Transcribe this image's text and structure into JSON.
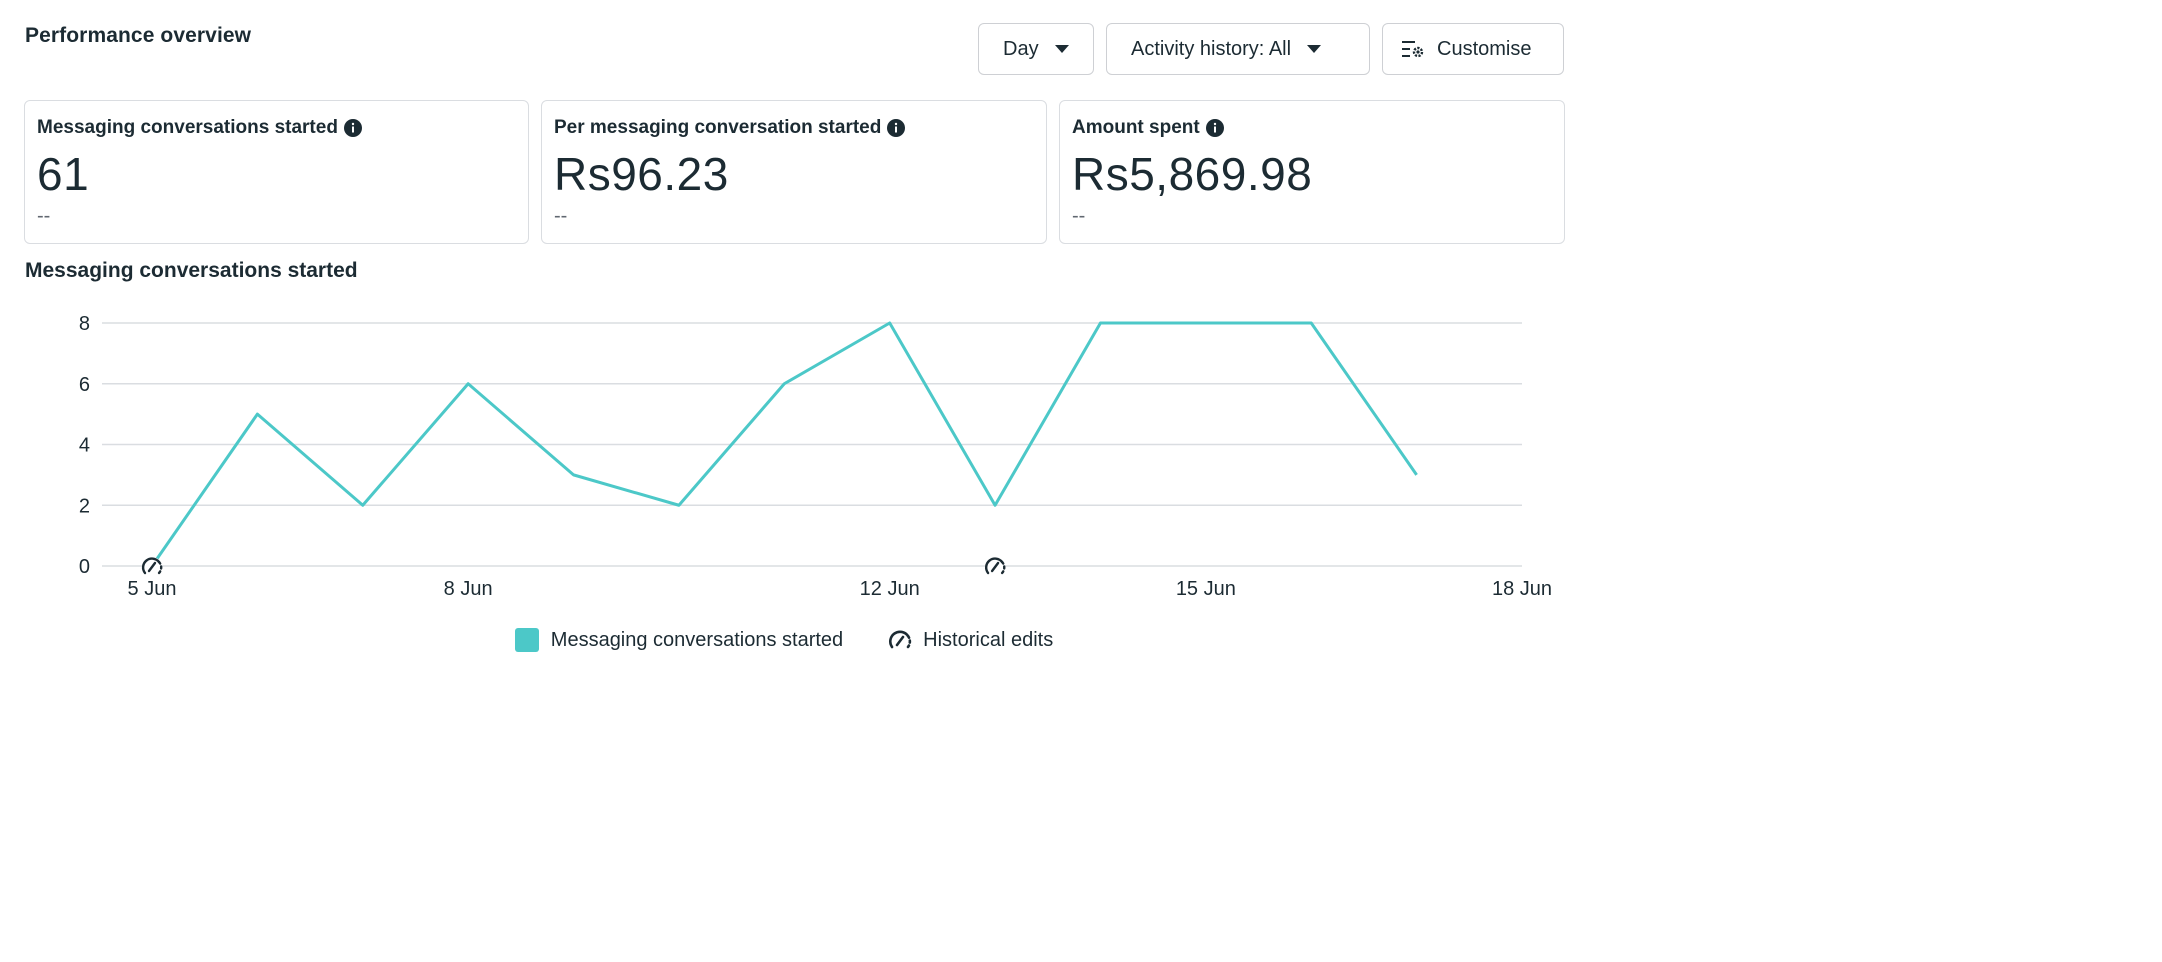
{
  "header": {
    "title": "Performance overview"
  },
  "controls": {
    "day_label": "Day",
    "activity_label": "Activity history: All",
    "customise_label": "Customise"
  },
  "cards": [
    {
      "label": "Messaging conversations started",
      "value": "61",
      "delta": "--"
    },
    {
      "label": "Per messaging conversation started",
      "value": "Rs96.23",
      "delta": "--"
    },
    {
      "label": "Amount spent",
      "value": "Rs5,869.98",
      "delta": "--"
    }
  ],
  "chart_section": {
    "title": "Messaging conversations started"
  },
  "legend": {
    "series_label": "Messaging conversations started",
    "edits_label": "Historical edits"
  },
  "colors": {
    "series": "#4cc8c8",
    "grid": "#dadde1",
    "text": "#1c2b33"
  },
  "chart_data": {
    "type": "line",
    "x_labels": [
      "5 Jun",
      "8 Jun",
      "12 Jun",
      "15 Jun",
      "18 Jun"
    ],
    "x_label_days": [
      5,
      8,
      12,
      15,
      18
    ],
    "x_range": [
      5,
      18
    ],
    "x": [
      5,
      6,
      7,
      8,
      9,
      10,
      11,
      12,
      13,
      14,
      15,
      16,
      17
    ],
    "series": [
      {
        "name": "Messaging conversations started",
        "values": [
          0,
          5,
          2,
          6,
          3,
          2,
          6,
          8,
          2,
          8,
          8,
          8,
          3
        ]
      }
    ],
    "y_ticks": [
      0,
      2,
      4,
      6,
      8
    ],
    "ylim": [
      0,
      8
    ],
    "historical_edits_days": [
      5,
      13
    ],
    "grid": true,
    "legend_position": "bottom"
  }
}
